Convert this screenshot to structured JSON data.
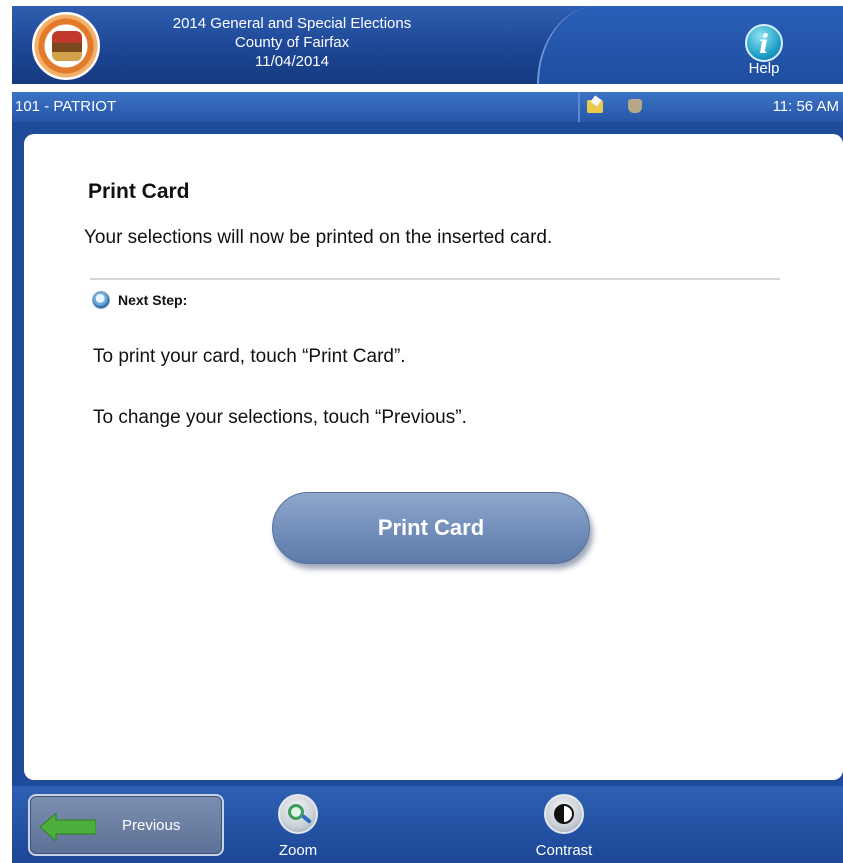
{
  "header": {
    "election_name": "2014 General and Special Elections",
    "county": "County of Fairfax",
    "date": "11/04/2014",
    "help_label": "Help",
    "help_glyph": "i",
    "colors": {
      "bar": "#1d4695",
      "accent": "#2a5fb8"
    }
  },
  "status": {
    "precinct": "101 - PATRIOT",
    "time": "11: 56 AM",
    "icons": [
      "note-icon",
      "shield-icon"
    ]
  },
  "main": {
    "title": "Print Card",
    "instruction": "Your selections will now be printed on the inserted card.",
    "next_step_label": "Next Step:",
    "step_print": "To print your card, touch “Print Card”.",
    "step_change": "To change your selections, touch “Previous”.",
    "print_button": "Print Card"
  },
  "toolbar": {
    "previous": "Previous",
    "zoom": "Zoom",
    "contrast": "Contrast"
  }
}
